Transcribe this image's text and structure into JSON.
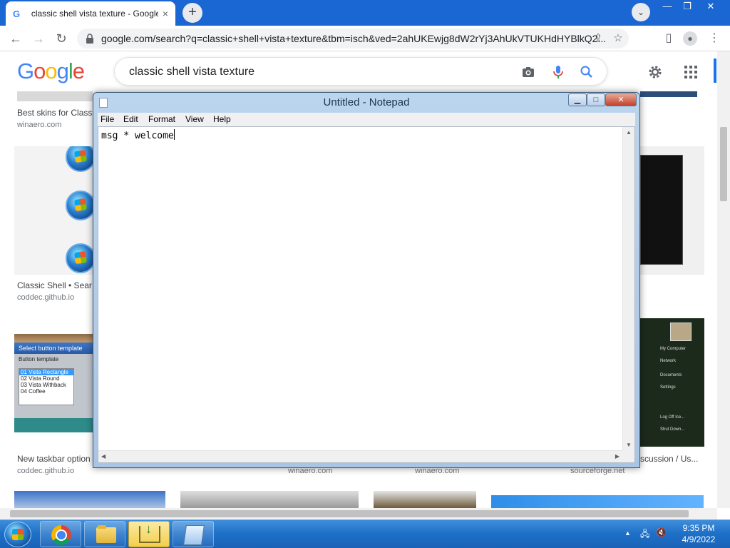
{
  "browser": {
    "tab_title": "classic shell vista texture - Google",
    "tab_favicon": "G",
    "tab_close": "×",
    "new_tab": "+",
    "tab_search": "⌄",
    "url": "google.com/search?q=classic+shell+vista+texture&tbm=isch&ved=2ahUKEwjg8dW2rYj3AhUkVTUKHdHYBlkQ2...",
    "window_controls": {
      "minimize": "—",
      "restore": "❐",
      "close": "✕"
    },
    "icons": {
      "back": "←",
      "forward": "→",
      "reload": "↻",
      "share": "⇪",
      "star": "☆",
      "sidebar": "▯",
      "profile": "●",
      "menu": "⋮"
    }
  },
  "google": {
    "logo_letters": [
      "G",
      "o",
      "o",
      "g",
      "l",
      "e"
    ],
    "logo_colors": [
      "#4285f4",
      "#ea4335",
      "#fbbc05",
      "#4285f4",
      "#34a853",
      "#ea4335"
    ],
    "query": "classic shell vista texture",
    "results": [
      {
        "caption": "Best skins for Class",
        "source": "winaero.com"
      },
      {
        "caption": "Classic Shell • Sear",
        "source": "coddec.github.io"
      },
      {
        "caption": "New taskbar option",
        "source": "coddec.github.io"
      },
      {
        "caption": "",
        "source": "winaero.com"
      },
      {
        "caption": "",
        "source": "winaero.com"
      },
      {
        "caption": "scussion / Us...",
        "source": "sourceforge.net"
      }
    ],
    "thumb_template": {
      "title": "Select button template",
      "label": "Button template",
      "options": [
        "01 Vista Rectangle",
        "02 Vista Round",
        "03 Vista Withback",
        "04 Coffee"
      ]
    },
    "thumb_startmenu": [
      "My Computer",
      "Network",
      "Documents",
      "Settings",
      "Log Off Ice...",
      "Shut Down..."
    ]
  },
  "notepad": {
    "title": "Untitled - Notepad",
    "menu": [
      "File",
      "Edit",
      "Format",
      "View",
      "Help"
    ],
    "content": "msg * welcome",
    "controls": {
      "minimize": "▁",
      "maximize": "□",
      "close": "✕"
    }
  },
  "taskbar": {
    "clock_time": "9:35 PM",
    "clock_date": "4/9/2022",
    "tray": {
      "show_hidden": "▲",
      "network": "🖧",
      "volume": "🔇"
    }
  },
  "colors": {
    "chrome_tabstrip": "#1a66d2",
    "taskbar": "#1d6fc7",
    "notepad_frame": "#bcd5ee",
    "active_task": "#f2cf4b"
  }
}
